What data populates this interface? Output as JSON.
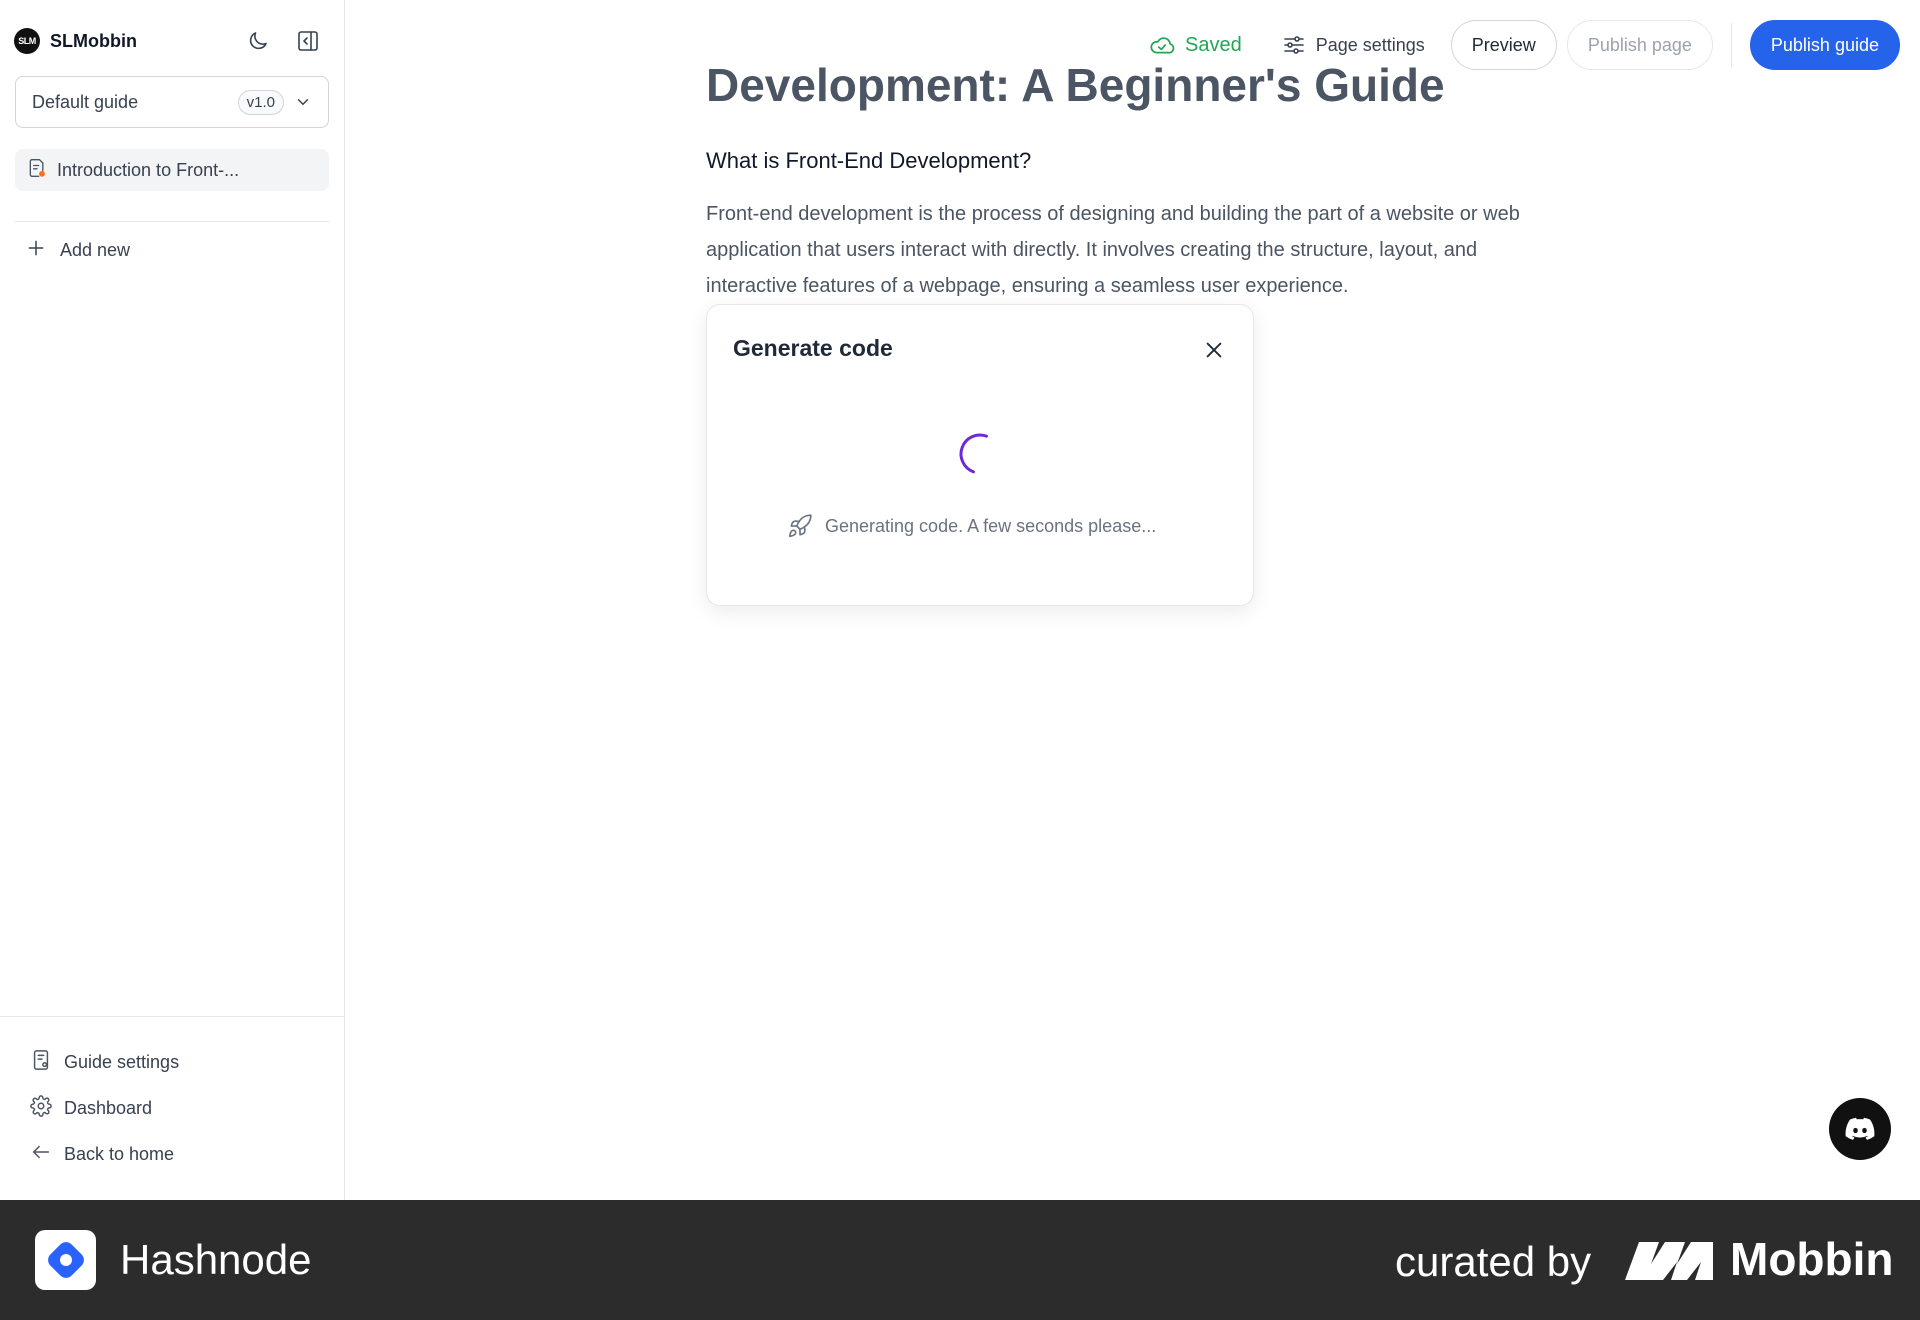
{
  "sidebar": {
    "brand_logo_text": "SLM",
    "brand_name": "SLMobbin",
    "guide_select": {
      "label": "Default guide",
      "version": "v1.0"
    },
    "pages": [
      {
        "label": "Introduction to Front-..."
      }
    ],
    "add_new_label": "Add new",
    "bottom_items": [
      {
        "label": "Guide settings",
        "icon": "guide-settings-icon"
      },
      {
        "label": "Dashboard",
        "icon": "gear-icon"
      },
      {
        "label": "Back to home",
        "icon": "arrow-left-icon"
      }
    ]
  },
  "topbar": {
    "saved_label": "Saved",
    "page_settings_label": "Page settings",
    "preview_label": "Preview",
    "publish_page_label": "Publish page",
    "publish_guide_label": "Publish guide"
  },
  "document": {
    "title": "Development: A Beginner's Guide",
    "heading": "What is Front-End Development?",
    "paragraph": "Front-end development is the process of designing and building the part of a website or web application that users interact with directly. It involves creating the structure, layout, and interactive features of a webpage, ensuring a seamless user experience."
  },
  "modal": {
    "title": "Generate code",
    "message": "Generating code. A few seconds please..."
  },
  "footer": {
    "left_name": "Hashnode",
    "curated_by": "curated by",
    "right_name": "Mobbin"
  },
  "colors": {
    "accent": "#2563eb",
    "saved": "#22a652",
    "spinner": "#6d28d9",
    "footer_bg": "#2c2c2c"
  }
}
